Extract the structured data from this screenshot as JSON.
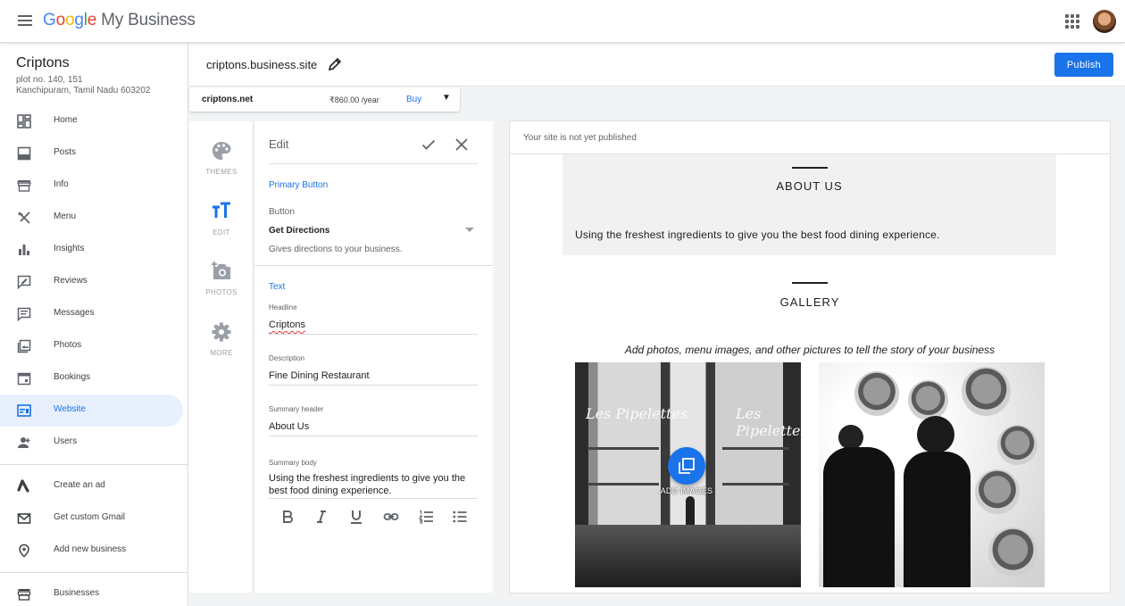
{
  "app": {
    "logo_letters": [
      "G",
      "o",
      "o",
      "g",
      "l",
      "e"
    ],
    "product": "My Business"
  },
  "business": {
    "name": "Criptons",
    "address_line1": "plot no. 140, 151",
    "address_line2": "Kanchipuram, Tamil Nadu 603202"
  },
  "sidebar": {
    "items": [
      {
        "label": "Home",
        "icon": "home-dashboard-icon"
      },
      {
        "label": "Posts",
        "icon": "posts-icon"
      },
      {
        "label": "Info",
        "icon": "store-icon"
      },
      {
        "label": "Menu",
        "icon": "utensils-icon"
      },
      {
        "label": "Insights",
        "icon": "bar-chart-icon"
      },
      {
        "label": "Reviews",
        "icon": "review-icon"
      },
      {
        "label": "Messages",
        "icon": "message-icon"
      },
      {
        "label": "Photos",
        "icon": "photo-icon"
      },
      {
        "label": "Bookings",
        "icon": "calendar-icon"
      },
      {
        "label": "Website",
        "icon": "website-icon",
        "active": true
      },
      {
        "label": "Users",
        "icon": "add-user-icon"
      }
    ],
    "extra_items": [
      {
        "label": "Create an ad",
        "icon": "ads-icon"
      },
      {
        "label": "Get custom Gmail",
        "icon": "gmail-icon"
      },
      {
        "label": "Add new business",
        "icon": "location-pin-icon"
      }
    ],
    "bottom_items": [
      {
        "label": "Businesses",
        "icon": "storefront-icon"
      }
    ]
  },
  "header": {
    "site_url": "criptons.business.site",
    "publish_label": "Publish"
  },
  "domain": {
    "name": "criptons.net",
    "price": "₹860.00 /year",
    "buy_label": "Buy",
    "caret": "▼"
  },
  "tools": [
    {
      "label": "THEMES",
      "icon": "palette-icon"
    },
    {
      "label": "EDIT",
      "icon": "text-format-icon",
      "active": true
    },
    {
      "label": "PHOTOS",
      "icon": "add-photo-icon"
    },
    {
      "label": "MORE",
      "icon": "gear-icon"
    }
  ],
  "edit": {
    "title": "Edit",
    "primary_section": "Primary Button",
    "button_caption": "Button",
    "button_value": "Get Directions",
    "button_hint": "Gives directions to your business.",
    "text_section": "Text",
    "headline_caption": "Headline",
    "headline_value": "Criptons",
    "description_caption": "Description",
    "description_value": "Fine Dining Restaurant",
    "summary_header_caption": "Summary header",
    "summary_header_value": "About Us",
    "summary_body_caption": "Summary body",
    "summary_body_value": "Using the freshest ingredients to give you the best food dining experience.",
    "format_buttons": [
      "bold-icon",
      "italic-icon",
      "underline-icon",
      "link-icon",
      "numbered-list-icon",
      "bulleted-list-icon"
    ]
  },
  "preview": {
    "banner": "Your site is not yet published",
    "about_title": "ABOUT US",
    "about_body": "Using the freshest ingredients to give you the best food dining experience.",
    "gallery_title": "GALLERY",
    "gallery_subtitle": "Add photos, menu images, and other pictures to tell the story of your business",
    "add_images_label": "ADD IMAGES",
    "store_sign_text": "Les Pipelettes"
  },
  "colors": {
    "accent": "#1a73e8",
    "active_bg": "#e8f0fe"
  }
}
